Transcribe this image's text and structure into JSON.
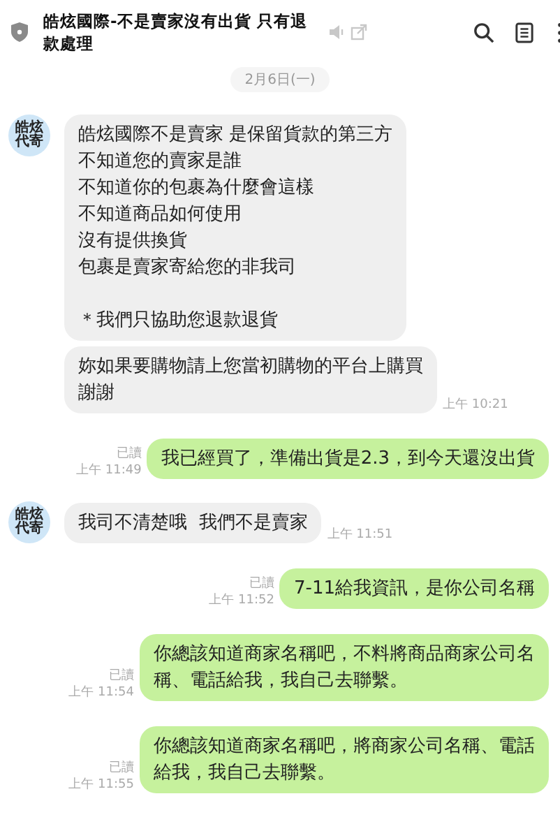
{
  "header": {
    "title": "皓炫國際-不是賣家沒有出貨 只有退款處理"
  },
  "date": "2月6日(一)",
  "messages": [
    {
      "kind": "in",
      "avatar": true,
      "avatar_text": [
        "皓炫",
        "代寄"
      ],
      "paragraphs": [
        [
          "皓炫國際不是賣家 是保留貨款的第三方",
          "不知道您的賣家是誰",
          "不知道你的包裹為什麼會這樣",
          "不知道商品如何使用",
          "沒有提供換貨",
          "包裹是賣家寄給您的非我司"
        ],
        [
          "＊我們只協助您退款退貨"
        ]
      ]
    },
    {
      "kind": "in",
      "avatar": false,
      "paragraphs": [
        [
          "妳如果要購物請上您當初購物的平台上購買",
          "謝謝"
        ]
      ],
      "time": "上午 10:21"
    },
    {
      "kind": "out",
      "read": "已讀",
      "time": "上午 11:49",
      "paragraphs": [
        [
          "我已經買了，準備出貨是2.3，到今天還沒出貨"
        ]
      ]
    },
    {
      "kind": "in",
      "avatar": true,
      "avatar_text": [
        "皓炫",
        "代寄"
      ],
      "paragraphs": [
        [
          "我司不清楚哦  我們不是賣家"
        ]
      ],
      "time": "上午 11:51"
    },
    {
      "kind": "out",
      "read": "已讀",
      "time": "上午 11:52",
      "paragraphs": [
        [
          "7-11給我資訊，是你公司名稱"
        ]
      ]
    },
    {
      "kind": "out",
      "read": "已讀",
      "time": "上午 11:54",
      "paragraphs": [
        [
          "你總該知道商家名稱吧，不料將商品商家公司名",
          "稱、電話給我，我自己去聯繫。"
        ]
      ]
    },
    {
      "kind": "out",
      "read": "已讀",
      "time": "上午 11:55",
      "paragraphs": [
        [
          "你總該知道商家名稱吧，將商家公司名稱、電話",
          "給我，我自己去聯繫。"
        ]
      ]
    }
  ]
}
